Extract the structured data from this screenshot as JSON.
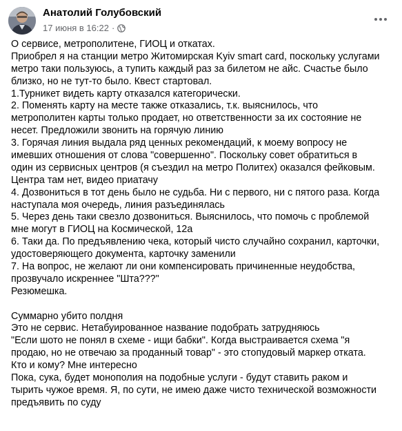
{
  "post": {
    "author": "Анатолий Голубовский",
    "date": "17 июня в 16:22",
    "separator": "·",
    "privacy_icon": "globe-icon",
    "more_icon": "more-horizontal-icon",
    "paragraph1": [
      "О сервисе, метрополитене, ГИОЦ и откатах.",
      "Приобрел я на станции метро Житомирская Kyiv smart card, поскольку услугами",
      "метро таки пользуюсь, а тупить каждый раз за билетом не айс. Счастье было",
      "близко, но не тут-то было. Квест стартовал.",
      "1.Турникет видеть карту отказался категорически.",
      "2. Поменять карту на месте также отказались, т.к. выяснилось, что",
      "метрополитен карты только продает, но ответственности за их состояние не",
      "несет. Предложили звонить на горячую линию",
      "3. Горячая линия выдала ряд ценных рекомендаций, к моему вопросу не",
      "имевших отношения от слова \"совершенно\". Поскольку совет обратиться в",
      "один из сервисных центров (я съездил на метро Политех) оказался фейковым.",
      "Центра там нет, видео приатачу",
      "4. Дозвониться в тот день было не судьба. Ни с первого, ни с пятого раза. Когда",
      "наступала моя очередь, линия разъединялась",
      "5. Через день таки свезло дозвониться. Выяснилось, что помочь с проблемой",
      "мне могут в ГИОЦ на Космической, 12а",
      "6. Таки да. По предъявлению чека, который чисто случайно сохранил, карточки,",
      "удостоверяющего документа, карточку заменили",
      "7. На вопрос, не желают ли они компенсировать причиненные неудобства,",
      "прозвучало искреннее \"Шта???\"",
      "Резюмешка."
    ],
    "paragraph2": [
      "Суммарно убито полдня",
      "Это не сервис. Нетабуированное название подобрать затрудняюсь",
      "\"Если шото не понял в схеме - ищи бабки\". Когда выстраивается схема \"я",
      "продаю, но не отвечаю за проданный товар\" - это стопудовый маркер отката.",
      "Кто и кому? Мне интересно",
      "Пока, сука, будет монополия на подобные услуги - будут ставить раком и",
      "тырить чужое время. Я, по сути, не имею даже чисто технической возможности",
      "предъявить по суду"
    ]
  },
  "colors": {
    "text_primary": "#050505",
    "text_secondary": "#65676b",
    "background": "#ffffff"
  }
}
